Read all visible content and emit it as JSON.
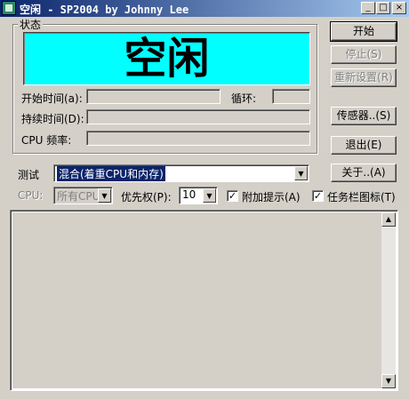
{
  "window": {
    "title": "空闲 - SP2004 by Johnny Lee",
    "minimize": "_",
    "maximize": "□",
    "close": "×"
  },
  "status_group": {
    "label": "状态",
    "display_text": "空闲",
    "start_time_label": "开始时间(a):",
    "loop_label": "循环:",
    "duration_label": "持续时间(D):",
    "cpu_freq_label": "CPU 频率:"
  },
  "buttons": {
    "start": "开始",
    "stop": "停止(S)",
    "reset": "重新设置(R)",
    "sensor": "传感器..(S)",
    "exit": "退出(E)",
    "about": "关于..(A)"
  },
  "test": {
    "label": "测试",
    "selected": "混合(着重CPU和内存)"
  },
  "cpu": {
    "label": "CPU:",
    "selected": "所有CPU"
  },
  "priority": {
    "label": "优先权(P):",
    "selected": "10"
  },
  "checkboxes": {
    "extra_hint_label": "附加提示(A)",
    "extra_hint_checked": true,
    "tray_icon_label": "任务栏图标(T)",
    "tray_icon_checked": true
  },
  "colors": {
    "status_display": "#00ffff",
    "title_gradient_start": "#0a246a",
    "title_gradient_end": "#a6caf0"
  }
}
